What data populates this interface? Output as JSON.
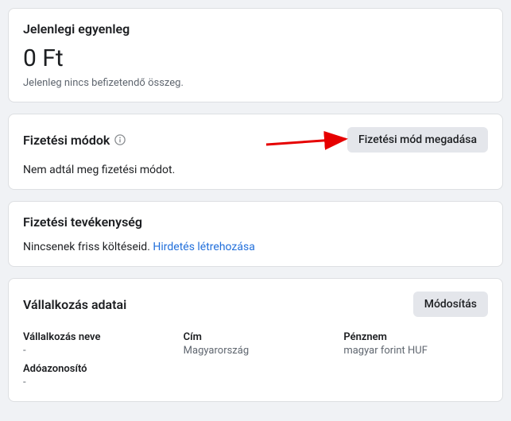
{
  "balance": {
    "title": "Jelenlegi egyenleg",
    "amount": "0 Ft",
    "note": "Jelenleg nincs befizetendő összeg."
  },
  "payment_methods": {
    "title": "Fizetési módok",
    "add_button": "Fizetési mód megadása",
    "empty_text": "Nem adtál meg fizetési módot."
  },
  "activity": {
    "title": "Fizetési tevékenység",
    "empty_text": "Nincsenek friss költéseid. ",
    "link_text": "Hirdetés létrehozása"
  },
  "business": {
    "title": "Vállalkozás adatai",
    "edit_button": "Módosítás",
    "name_label": "Vállalkozás neve",
    "name_value": "-",
    "tax_label": "Adóazonosító",
    "tax_value": "-",
    "address_label": "Cím",
    "address_value": "Magyarország",
    "currency_label": "Pénznem",
    "currency_value": "magyar forint HUF"
  }
}
